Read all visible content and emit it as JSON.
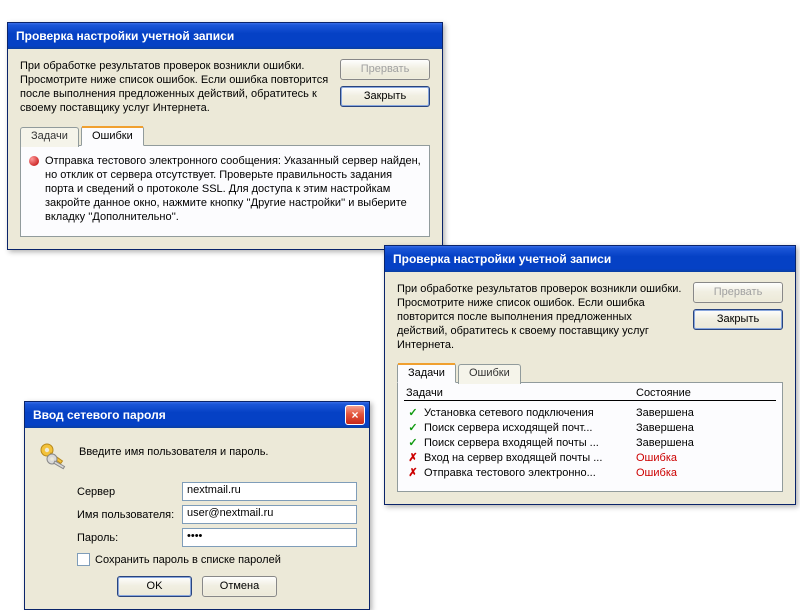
{
  "dlg1": {
    "title": "Проверка настройки учетной записи",
    "message": "При обработке результатов проверок возникли ошибки. Просмотрите ниже список ошибок. Если ошибка повторится после выполнения предложенных действий, обратитесь к своему поставщику услуг Интернета.",
    "btn_abort": "Прервать",
    "btn_close": "Закрыть",
    "tab_tasks": "Задачи",
    "tab_errors": "Ошибки",
    "error_text": "Отправка тестового электронного сообщения: Указанный сервер найден, но отклик от сервера отсутствует. Проверьте правильность задания порта и сведений о протоколе SSL. Для доступа к этим настройкам закройте данное окно, нажмите кнопку ''Другие настройки'' и выберите вкладку ''Дополнительно''."
  },
  "dlg2": {
    "title": "Проверка настройки учетной записи",
    "message": "При обработке результатов проверок возникли ошибки. Просмотрите ниже список ошибок. Если ошибка повторится после выполнения предложенных действий, обратитесь к своему поставщику услуг Интернета.",
    "btn_abort": "Прервать",
    "btn_close": "Закрыть",
    "tab_tasks": "Задачи",
    "tab_errors": "Ошибки",
    "col_tasks": "Задачи",
    "col_state": "Состояние",
    "rows": [
      {
        "icon": "check",
        "task": "Установка сетевого подключения",
        "state": "Завершена",
        "err": false
      },
      {
        "icon": "check",
        "task": "Поиск сервера исходящей почт...",
        "state": "Завершена",
        "err": false
      },
      {
        "icon": "check",
        "task": "Поиск сервера входящей почты ...",
        "state": "Завершена",
        "err": false
      },
      {
        "icon": "cross",
        "task": "Вход на сервер входящей почты ...",
        "state": "Ошибка",
        "err": true
      },
      {
        "icon": "cross",
        "task": "Отправка тестового электронно...",
        "state": "Ошибка",
        "err": true
      }
    ]
  },
  "pw": {
    "title": "Ввод сетевого пароля",
    "close_x": "×",
    "instr": "Введите имя пользователя и пароль.",
    "lbl_server": "Сервер",
    "val_server": "nextmail.ru",
    "lbl_user": "Имя пользователя:",
    "val_user": "user@nextmail.ru",
    "lbl_pass": "Пароль:",
    "val_pass": "••••",
    "chk_label": "Сохранить пароль в списке паролей",
    "btn_ok": "OK",
    "btn_cancel": "Отмена"
  }
}
